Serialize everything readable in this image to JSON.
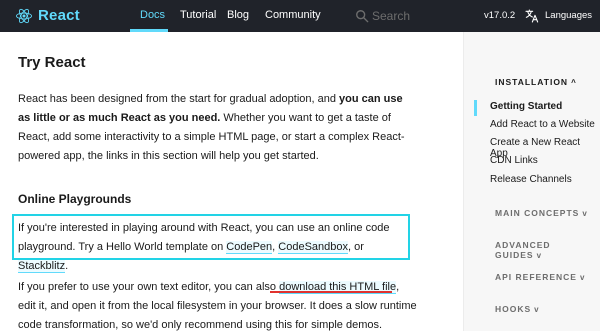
{
  "colors": {
    "nav_bg": "#20232a",
    "accent": "#61dafb",
    "highlight_box": "#22d3e6",
    "annotation_underline": "#e0322e"
  },
  "nav": {
    "brand": "React",
    "logo_icon": "react-atom-icon",
    "links": [
      "Docs",
      "Tutorial",
      "Blog",
      "Community"
    ],
    "active_link": "Docs",
    "search_placeholder": "Search",
    "version": "v17.0.2",
    "language_label": "Languages"
  },
  "main": {
    "title": "Try React",
    "intro": {
      "before": "React has been designed from the start for gradual adoption, and ",
      "bold": "you can use as little or as much React as you need.",
      "after": " Whether you want to get a taste of React, add some interactivity to a simple HTML page, or start a complex React-powered app, the links in this section will help you get started."
    },
    "online_heading": "Online Playgrounds",
    "playground": {
      "before": "If you're interested in playing around with React, you can use an online code playground. Try a Hello World template on ",
      "links": [
        "CodePen",
        "CodeSandbox",
        "Stackblitz"
      ],
      "sep1": ", ",
      "sep2": ", or ",
      "end": "."
    },
    "local": {
      "before": "If you prefer to use your own text editor, you can also ",
      "link": "download this HTML file",
      "after": ", edit it, and open it from the local filesystem in your browser. It does a slow runtime code transformation, so we'd only recommend using this for simple demos."
    }
  },
  "sidebar": {
    "sections": [
      {
        "label": "INSTALLATION",
        "expanded": true
      },
      {
        "label": "MAIN CONCEPTS",
        "expanded": false
      },
      {
        "label": "ADVANCED GUIDES",
        "expanded": false
      },
      {
        "label": "API REFERENCE",
        "expanded": false
      },
      {
        "label": "HOOKS",
        "expanded": false
      }
    ],
    "chevron_up": "^",
    "chevron_down": "v",
    "items": [
      "Getting Started",
      "Add React to a Website",
      "Create a New React App",
      "CDN Links",
      "Release Channels"
    ],
    "active_item": "Getting Started"
  }
}
